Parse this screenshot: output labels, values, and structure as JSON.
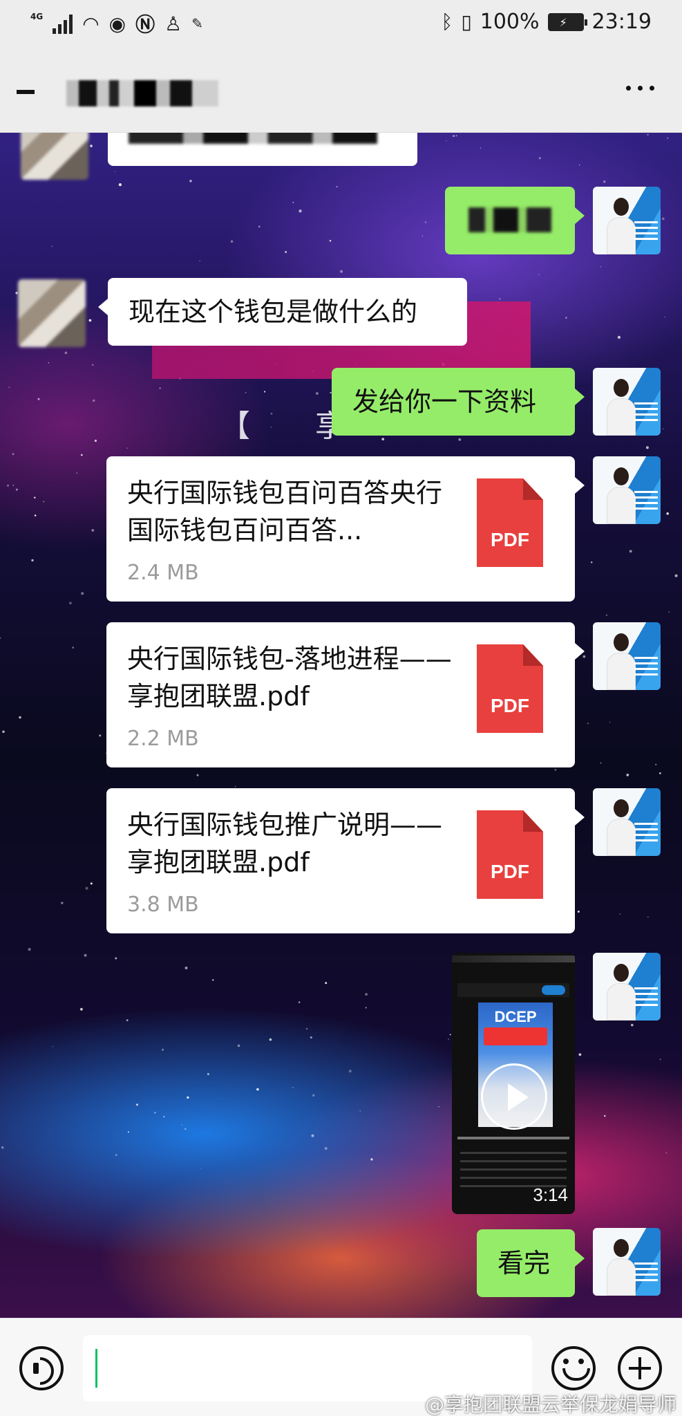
{
  "status_bar": {
    "network": "4G",
    "battery": "100%",
    "time": "23:19"
  },
  "header": {
    "more_icon": "more-dots-icon"
  },
  "messages": [
    {
      "type": "text",
      "side": "left",
      "text": "现在这个钱包是做什么的"
    },
    {
      "type": "text",
      "side": "right",
      "text": "发给你一下资料"
    },
    {
      "type": "file",
      "side": "right",
      "name": "央行国际钱包百问百答央行国际钱包百问百答...",
      "size": "2.4 MB",
      "icon_label": "PDF"
    },
    {
      "type": "file",
      "side": "right",
      "name": "央行国际钱包-落地进程——享抱团联盟.pdf",
      "size": "2.2 MB",
      "icon_label": "PDF"
    },
    {
      "type": "file",
      "side": "right",
      "name": "央行国际钱包推广说明——享抱团联盟.pdf",
      "size": "3.8 MB",
      "icon_label": "PDF"
    },
    {
      "type": "video",
      "side": "right",
      "title": "DCEP",
      "duration": "3:14"
    },
    {
      "type": "text",
      "side": "right",
      "text": "看完"
    }
  ],
  "background": {
    "bracket_text": "【 享"
  },
  "input_bar": {
    "voice_icon": "voice-icon",
    "emoji_icon": "emoji-icon",
    "plus_icon": "plus-icon"
  },
  "watermark": "@享抱团联盟云举保龙娟导师",
  "colors": {
    "bubble_self": "#95ec69",
    "bubble_other": "#ffffff",
    "pdf": "#e8403e",
    "caret": "#07c160"
  }
}
